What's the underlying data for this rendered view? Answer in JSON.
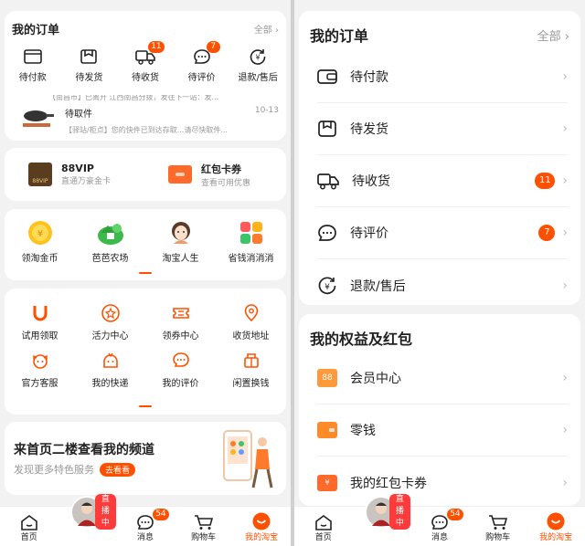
{
  "left": {
    "orders": {
      "title": "我的订单",
      "all": "全部",
      "items": [
        {
          "label": "待付款",
          "icon": "wallet-icon"
        },
        {
          "label": "待发货",
          "icon": "package-icon"
        },
        {
          "label": "待收货",
          "icon": "truck-icon",
          "badge": "11"
        },
        {
          "label": "待评价",
          "icon": "comment-icon",
          "badge": "7"
        },
        {
          "label": "退款/售后",
          "icon": "refund-icon"
        }
      ],
      "logistics_top": "【南昌市】已离开 江西南昌分拨，发往下一站：发...",
      "logistics_status": "待取件",
      "logistics_date": "10-13",
      "logistics_bottom": "【驿站/柜点】您的快件已到达存取...请尽快取件..."
    },
    "vip": {
      "name": "88VIP",
      "desc": "直通万豪金卡",
      "badge_text": "88VIP",
      "coupon_title": "红包卡券",
      "coupon_desc": "查看可用优惠"
    },
    "apps": [
      {
        "label": "领淘金币"
      },
      {
        "label": "芭芭农场"
      },
      {
        "label": "淘宝人生"
      },
      {
        "label": "省钱消消消"
      }
    ],
    "tools": [
      {
        "label": "试用领取"
      },
      {
        "label": "活力中心"
      },
      {
        "label": "领券中心"
      },
      {
        "label": "收货地址"
      },
      {
        "label": "官方客服"
      },
      {
        "label": "我的快递"
      },
      {
        "label": "我的评价"
      },
      {
        "label": "闲置换钱"
      }
    ],
    "promo": {
      "title": "来首页二楼查看我的频道",
      "subtitle": "发现更多特色服务",
      "button": "去看看"
    }
  },
  "right": {
    "orders": {
      "title": "我的订单",
      "all": "全部",
      "items": [
        {
          "label": "待付款"
        },
        {
          "label": "待发货"
        },
        {
          "label": "待收货",
          "badge": "11"
        },
        {
          "label": "待评价",
          "badge": "7"
        },
        {
          "label": "退款/售后"
        }
      ]
    },
    "benefits": {
      "title": "我的权益及红包",
      "items": [
        {
          "label": "会员中心",
          "badge_text": "88"
        },
        {
          "label": "零钱"
        },
        {
          "label": "我的红包卡券"
        }
      ]
    }
  },
  "tabbar": {
    "home": "首页",
    "live": "直播中",
    "messages": "消息",
    "messages_badge": "54",
    "cart": "购物车",
    "mine": "我的淘宝"
  },
  "colors": {
    "accent": "#ff5000",
    "bg": "#f2f2f2"
  }
}
